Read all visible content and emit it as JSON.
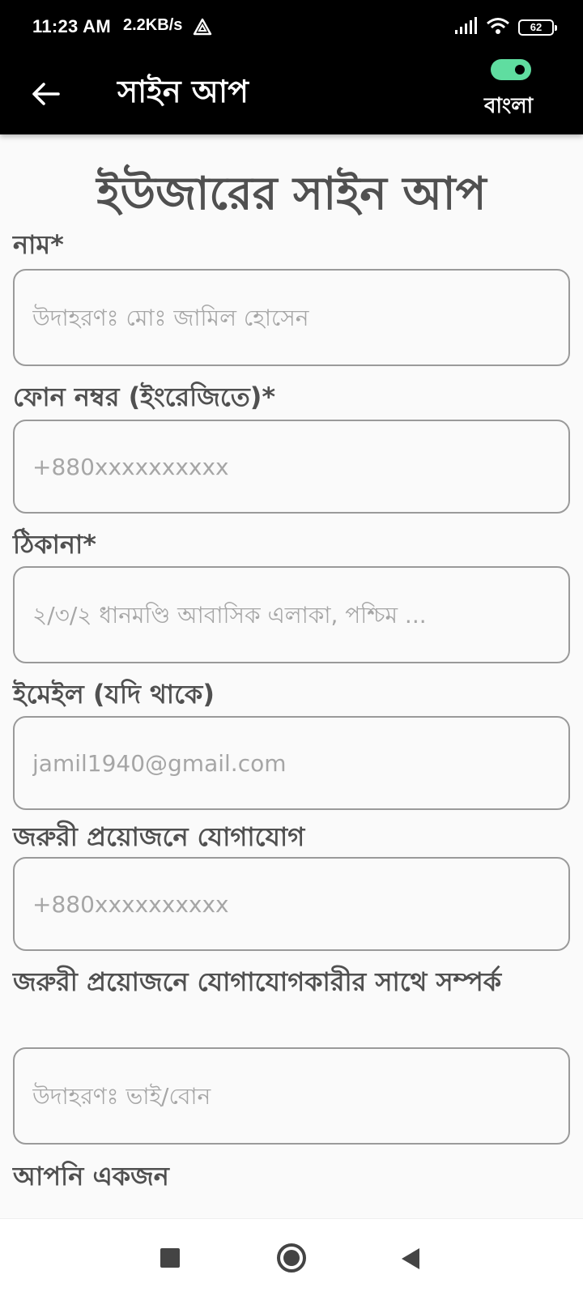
{
  "status_bar": {
    "time": "11:23 AM",
    "network_speed": "2.2KB/s",
    "battery": "62",
    "icons": [
      "drive-icon",
      "signal-icon",
      "wifi-icon",
      "battery-icon"
    ]
  },
  "app_bar": {
    "title": "সাইন আপ",
    "back_icon": "arrow-left-icon",
    "language_label": "বাংলা",
    "language_toggle_on": true,
    "toggle_color": "#5fdda0"
  },
  "form": {
    "title": "ইউজারের সাইন আপ",
    "fields": [
      {
        "label": "নাম*",
        "placeholder": "উদাহরণঃ মোঃ জামিল হোসেন",
        "value": ""
      },
      {
        "label": "ফোন নম্বর (ইংরেজিতে)*",
        "placeholder": "+880xxxxxxxxxx",
        "value": ""
      },
      {
        "label": "ঠিকানা*",
        "placeholder": "২/৩/২ ধানমণ্ডি আবাসিক এলাকা, পশ্চিম ...",
        "value": ""
      },
      {
        "label": "ইমেইল (যদি থাকে)",
        "placeholder": "jamil1940@gmail.com",
        "value": ""
      },
      {
        "label": "জরুরী প্রয়োজনে যোগাযোগ",
        "placeholder": "+880xxxxxxxxxx",
        "value": ""
      },
      {
        "label": "জরুরী প্রয়োজনে যোগাযোগকারীর সাথে সম্পর্ক",
        "placeholder": "উদাহরণঃ ভাই/বোন",
        "value": ""
      }
    ],
    "next_label": "আপনি একজন"
  },
  "nav_bar": {
    "icons": [
      "recent-apps-icon",
      "home-icon",
      "back-icon"
    ]
  }
}
